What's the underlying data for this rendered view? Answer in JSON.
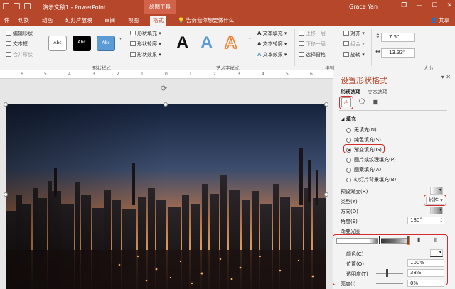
{
  "window": {
    "doc_title": "演示文稿1 - PowerPoint",
    "context_tools": "绘图工具",
    "user": "Grace Yan",
    "controls": [
      "—",
      "❐",
      "☐",
      "✕"
    ]
  },
  "tabs": [
    "件",
    "切换",
    "动画",
    "幻灯片放映",
    "审阅",
    "视图",
    "格式"
  ],
  "active_tab": "格式",
  "tell_me": "告诉我你想要做什么",
  "share": "共享",
  "ribbon": {
    "insert_shape": {
      "edit_shape": "编辑形状",
      "text_box": "文本框",
      "merge_shape": "合并形状"
    },
    "shape_styles": {
      "label": "形状样式",
      "sample": "Abc",
      "fill": "形状填充",
      "outline": "形状轮廓",
      "effect": "形状效果"
    },
    "wordart": {
      "label": "艺术字样式",
      "letter": "A",
      "text_fill": "文本填充",
      "text_outline": "文本轮廓",
      "text_effect": "文本效果"
    },
    "arrange": {
      "label": "排列",
      "bring_forward": "上移一层",
      "send_backward": "下移一层",
      "selection_pane": "选择窗格",
      "align": "对齐",
      "group": "组合",
      "rotate": "旋转"
    },
    "size": {
      "label": "大小",
      "height": "7.5\"",
      "width": "13.33\""
    }
  },
  "ruler": [
    "6",
    "5",
    "4",
    "3",
    "2",
    "1",
    "0",
    "1",
    "2",
    "3",
    "4",
    "5",
    "6"
  ],
  "pane": {
    "title": "设置形状格式",
    "tab_shape": "形状选项",
    "tab_text": "文本选项",
    "section_fill": "填充",
    "fill_options": [
      "无填充(N)",
      "纯色填充(S)",
      "渐变填充(G)",
      "图片或纹理填充(P)",
      "图案填充(A)",
      "幻灯片背景填充(B)"
    ],
    "fill_selected": "渐变填充(G)",
    "preset": "预设渐变(R)",
    "type_label": "类型(Y)",
    "type_value": "线性",
    "direction": "方向(D)",
    "angle_label": "角度(E)",
    "angle_value": "180°",
    "stops_label": "渐变光圈",
    "color_label": "颜色(C)",
    "position_label": "位置(O)",
    "position_value": "100%",
    "transparency_label": "透明度(T)",
    "transparency_value": "38%",
    "brightness_label": "亮度(I)",
    "brightness_value": "0%"
  },
  "colors": {
    "accent": "#b7472a",
    "highlight": "#d42b2b",
    "ribbon": "#f3f3f3"
  }
}
